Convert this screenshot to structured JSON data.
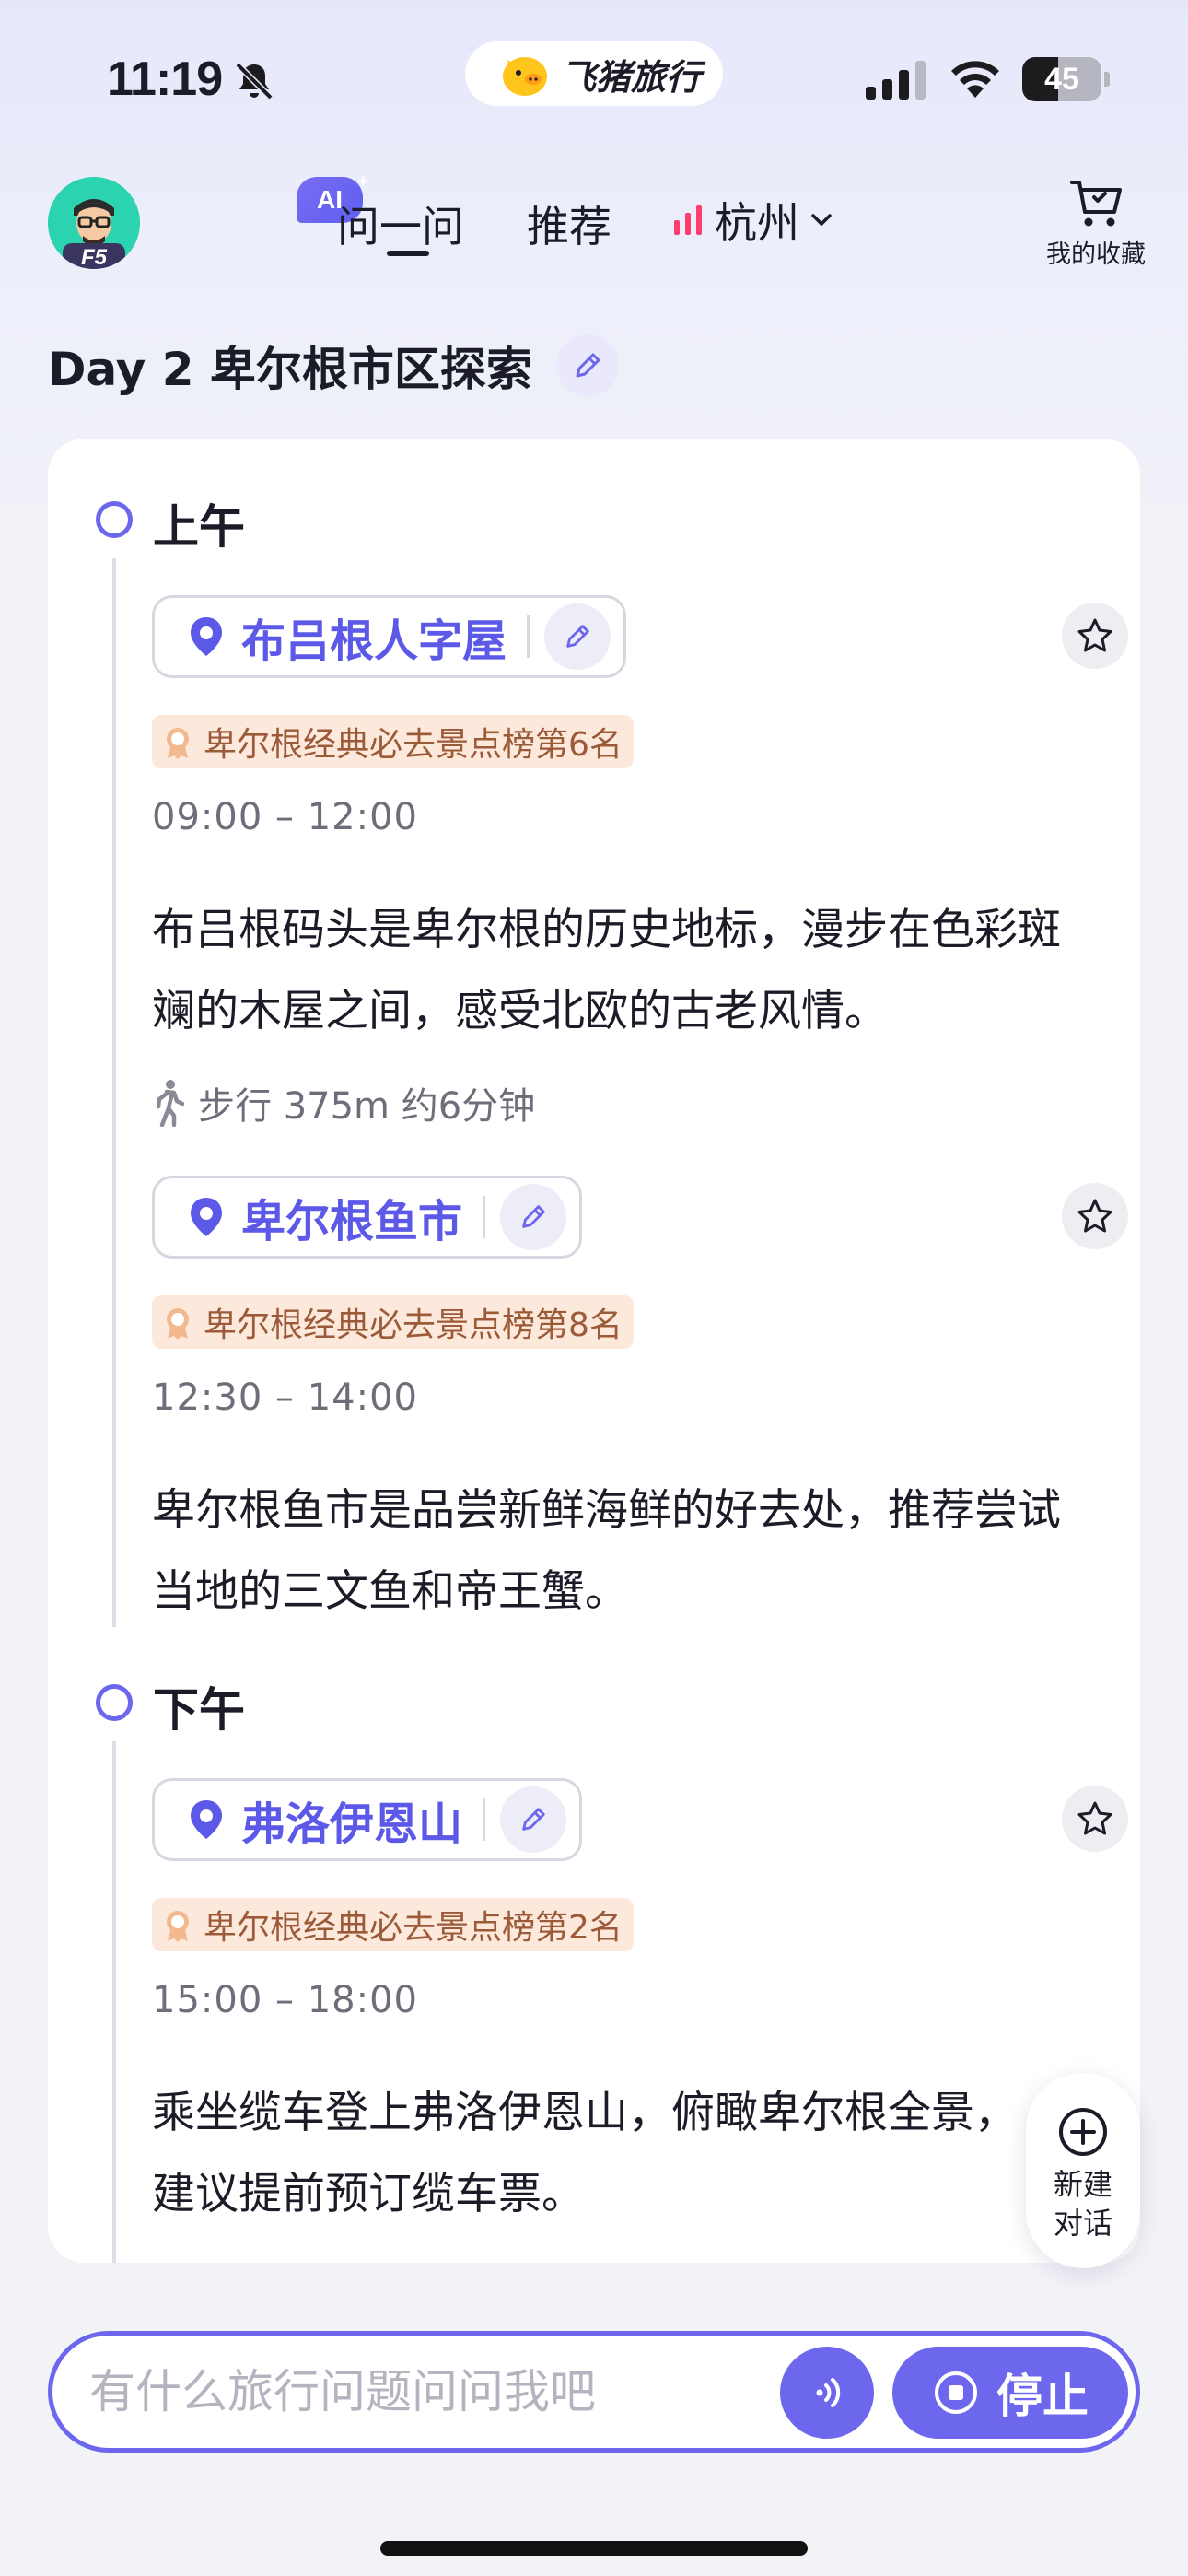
{
  "status_bar": {
    "time": "11:19",
    "brand": "飞猪旅行",
    "battery": "45",
    "battery_level_percent": 45
  },
  "header": {
    "ai_badge": "AI",
    "tabs": {
      "ask": "问一问",
      "recommend": "推荐"
    },
    "city": "杭州",
    "favorites_label": "我的收藏",
    "avatar_text": "F5"
  },
  "day_title": "Day 2 卑尔根市区探索",
  "itinerary": {
    "morning": {
      "label": "上午",
      "stops": [
        {
          "name": "布吕根人字屋",
          "rank": "卑尔根经典必去景点榜第6名",
          "time": "09:00 – 12:00",
          "description": "布吕根码头是卑尔根的历史地标，漫步在色彩斑斓的木屋之间，感受北欧的古老风情。"
        },
        {
          "name": "卑尔根鱼市",
          "rank": "卑尔根经典必去景点榜第8名",
          "time": "12:30 – 14:00",
          "description": "卑尔根鱼市是品尝新鲜海鲜的好去处，推荐尝试当地的三文鱼和帝王蟹。"
        }
      ],
      "walk": "步行 375m 约6分钟"
    },
    "afternoon": {
      "label": "下午",
      "stops": [
        {
          "name": "弗洛伊恩山",
          "rank": "卑尔根经典必去景点榜第2名",
          "time": "15:00 – 18:00",
          "description": "乘坐缆车登上弗洛伊恩山，俯瞰卑尔根全景，建议提前预订缆车票。"
        }
      ]
    }
  },
  "new_chat": {
    "line1": "新建",
    "line2": "对话"
  },
  "input": {
    "placeholder": "有什么旅行问题问问我吧",
    "stop_label": "停止"
  },
  "colors": {
    "accent": "#6d67ee",
    "place_text": "#5c59e8",
    "rank_bg": "#fde9dc",
    "rank_text": "#9b5a38"
  },
  "icons": [
    "bell-slash-icon",
    "brand-pig-icon",
    "signal-icon",
    "wifi-icon",
    "battery-icon",
    "bars-icon",
    "chevron-down-icon",
    "cart-icon",
    "pencil-icon",
    "pin-icon",
    "star-icon",
    "medal-icon",
    "walk-icon",
    "plus-circle-icon",
    "voice-icon",
    "stop-circle-icon"
  ]
}
